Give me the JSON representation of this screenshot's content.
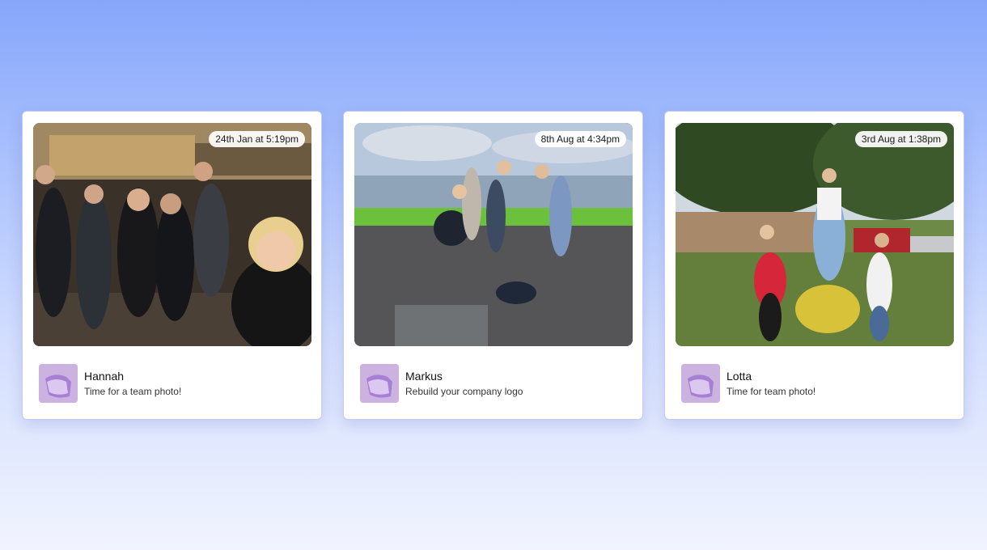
{
  "cards": [
    {
      "timestamp": "24th Jan at 5:19pm",
      "author": "Hannah",
      "caption": "Time for a team photo!",
      "photo_icon": "group-night-photo"
    },
    {
      "timestamp": "8th Aug at 4:34pm",
      "author": "Markus",
      "caption": "Rebuild your company logo",
      "photo_icon": "rooftop-logo-photo"
    },
    {
      "timestamp": "3rd Aug at 1:38pm",
      "author": "Lotta",
      "caption": "Time for team photo!",
      "photo_icon": "park-photo"
    }
  ],
  "avatar_icon": "purple-3d-shape-icon",
  "colors": {
    "background_top": "#86a6fb",
    "background_bottom": "#f1f4fe",
    "avatar": "#cbb2e1"
  }
}
